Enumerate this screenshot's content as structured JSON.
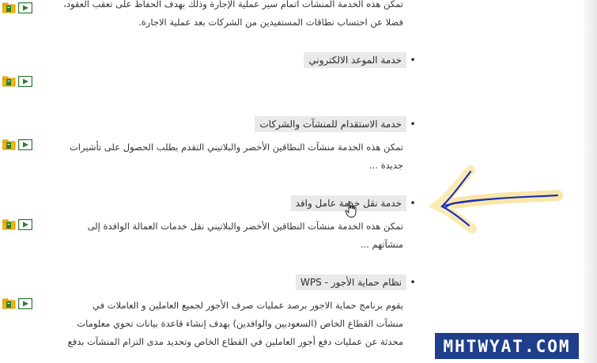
{
  "services": [
    {
      "title": "",
      "description": "تمكن هذه الخدمة المنشآت اتمام سير عملية الإجارة وذلك بهدف الحفاظ على تعقب العقود، فضلا عن احتساب نطاقات المستفيدين من الشركات بعد عملية الاجارة."
    },
    {
      "title": "خدمة الموعد الالكتروني",
      "description": ""
    },
    {
      "title": "خدمة الاستقدام للمنشآت والشركات",
      "description": "تمكن هذه الخدمة منشآت النطاقين الأخضر والبلاتيني التقدم بطلب الحصول على تأشيرات جديدة ..."
    },
    {
      "title": "خدمة نقل خدمة عامل وافد",
      "description": "تمكن هذه الخدمة منشآت النطاقين الأخضر والبلاتيني نقل خدمات العمالة الوافدة إلى منشآتهم ..."
    },
    {
      "title": "نظام حماية الأجور - WPS",
      "description": "يقوم برنامج حماية الاجور برصد عمليات صرف الأجور لجميع العاملين و العاملات في منشآت القطاع الخاص (السعوديين والوافدين) بهدف إنشاء قاعدة بيانات تحوي معلومات محدثة عن عمليات دفع أجور العاملين في القطاع الخاص وتحديد مدى التزام المنشآت بدفع"
    }
  ],
  "bullet": "•",
  "icons": {
    "folder": "folder-icon",
    "play": "play-icon"
  },
  "watermark": "MHTWYAT.COM",
  "colors": {
    "title_bg": "#e9e9e9",
    "icon_green": "#2f7d32",
    "icon_yellow": "#f2b705",
    "annotation_blue": "#1f2fb8",
    "annotation_glow": "#f4d35e",
    "watermark_bg": "#1f3f8c"
  }
}
